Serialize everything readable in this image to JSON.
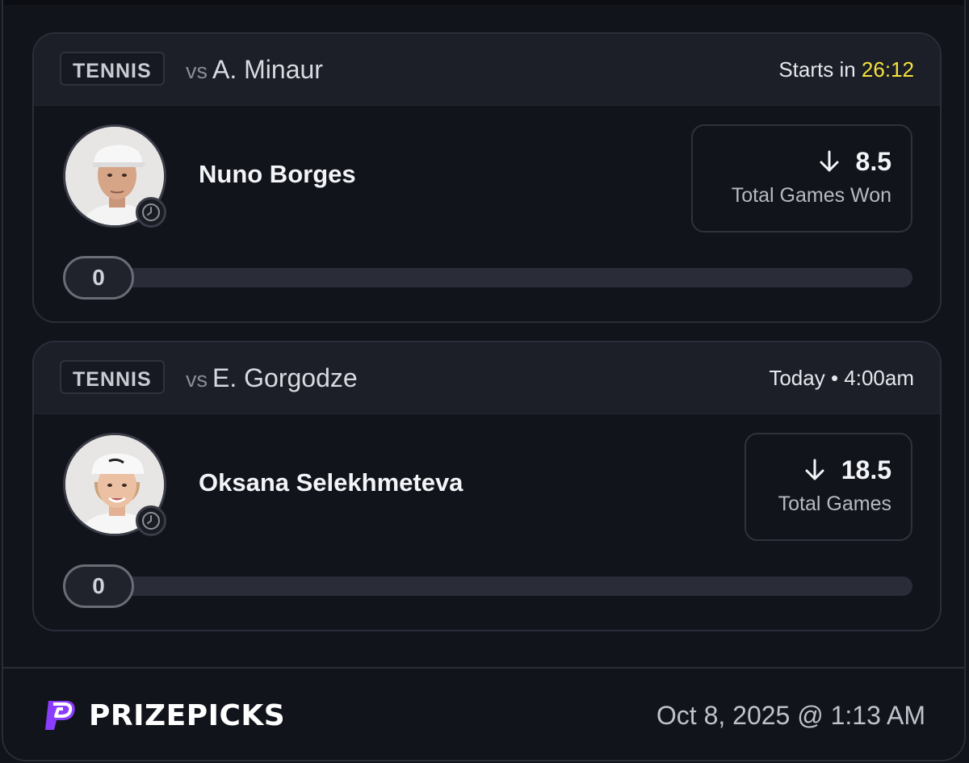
{
  "picks": [
    {
      "sport": "TENNIS",
      "vs_label": "vs",
      "opponent": "A. Minaur",
      "start_prefix": "Starts in",
      "start_time": "26:12",
      "player_name": "Nuno Borges",
      "direction": "down-arrow-icon",
      "line_value": "8.5",
      "stat": "Total Games Won",
      "progress_value": "0",
      "progress_fraction": 0
    },
    {
      "sport": "TENNIS",
      "vs_label": "vs",
      "opponent": "E. Gorgodze",
      "start_prefix": "Today • 4:00am",
      "start_time": "",
      "player_name": "Oksana Selekhmeteva",
      "direction": "down-arrow-icon",
      "line_value": "18.5",
      "stat": "Total Games",
      "progress_value": "0",
      "progress_fraction": 0
    }
  ],
  "footer": {
    "brand": "PRIZEPICKS",
    "timestamp": "Oct 8, 2025 @ 1:13 AM"
  },
  "colors": {
    "accent_time": "#f5e23a",
    "brand_purple": "#8b3dff"
  }
}
